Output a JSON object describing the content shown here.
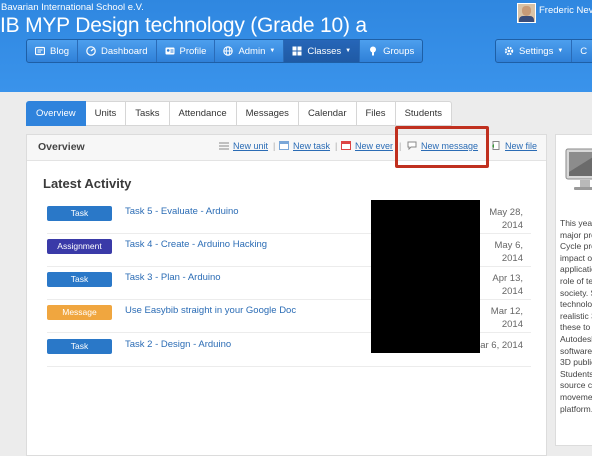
{
  "header": {
    "school": "Bavarian International School e.V.",
    "title": "IB MYP Design technology (Grade 10) a",
    "user_name": "Frederic Nev",
    "nav_left": [
      {
        "label": "Blog",
        "icon": "blog-icon"
      },
      {
        "label": "Dashboard",
        "icon": "dashboard-icon"
      },
      {
        "label": "Profile",
        "icon": "profile-card-icon"
      },
      {
        "label": "Admin",
        "icon": "globe-icon"
      },
      {
        "label": "Classes",
        "icon": "classes-icon"
      },
      {
        "label": "Groups",
        "icon": "groups-icon"
      }
    ],
    "nav_right": [
      {
        "label": "Settings",
        "icon": "gear-icon"
      },
      {
        "label": "C",
        "icon": "search-icon"
      }
    ],
    "active_nav": "Classes"
  },
  "tabs": [
    "Overview",
    "Units",
    "Tasks",
    "Attendance",
    "Messages",
    "Calendar",
    "Files",
    "Students"
  ],
  "active_tab": "Overview",
  "panel": {
    "title": "Overview",
    "actions": [
      {
        "label": "New unit",
        "icon": "unit-icon"
      },
      {
        "label": "New task",
        "icon": "calendar-task-icon"
      },
      {
        "label": "New even",
        "icon": "event-icon"
      },
      {
        "label": "New message",
        "icon": "message-icon"
      },
      {
        "label": "New file",
        "icon": "file-upload-icon"
      }
    ],
    "latest_heading": "Latest Activity",
    "activities": [
      {
        "type": "Task",
        "title": "Task 5 - Evaluate - Arduino",
        "date1": "May 28,",
        "date2": "2014",
        "color": "#2a78c8"
      },
      {
        "type": "Assignment",
        "title": "Task 4 - Create - Arduino Hacking",
        "date1": "May 6,",
        "date2": "2014",
        "color": "#3a3aa8"
      },
      {
        "type": "Task",
        "title": "Task 3 - Plan - Arduino",
        "date1": "Apr 13,",
        "date2": "2014",
        "color": "#2a78c8"
      },
      {
        "type": "Message",
        "title": "Use Easybib straight in your Google Doc",
        "date1": "Mar 12,",
        "date2": "2014",
        "color": "#f0a63f"
      },
      {
        "type": "Task",
        "title": "Task 2 - Design - Arduino",
        "date1": "Mar 6, 2014",
        "date2": "",
        "color": "#2a78c8"
      }
    ]
  },
  "sidebar": {
    "lines": [
      "This year",
      "major pro",
      "Cycle pro",
      "impact of",
      "application",
      "role of te",
      "society. S",
      "technolog",
      "realistic 3",
      "these to",
      "Autodesk",
      "software",
      "3D public",
      "Students",
      "source co",
      "movemen",
      "platform."
    ]
  },
  "colors": {
    "header": "#3a93eb",
    "highlight": "#c0301f",
    "link": "#2b6cb5",
    "tab_active": "#2f83dc"
  }
}
